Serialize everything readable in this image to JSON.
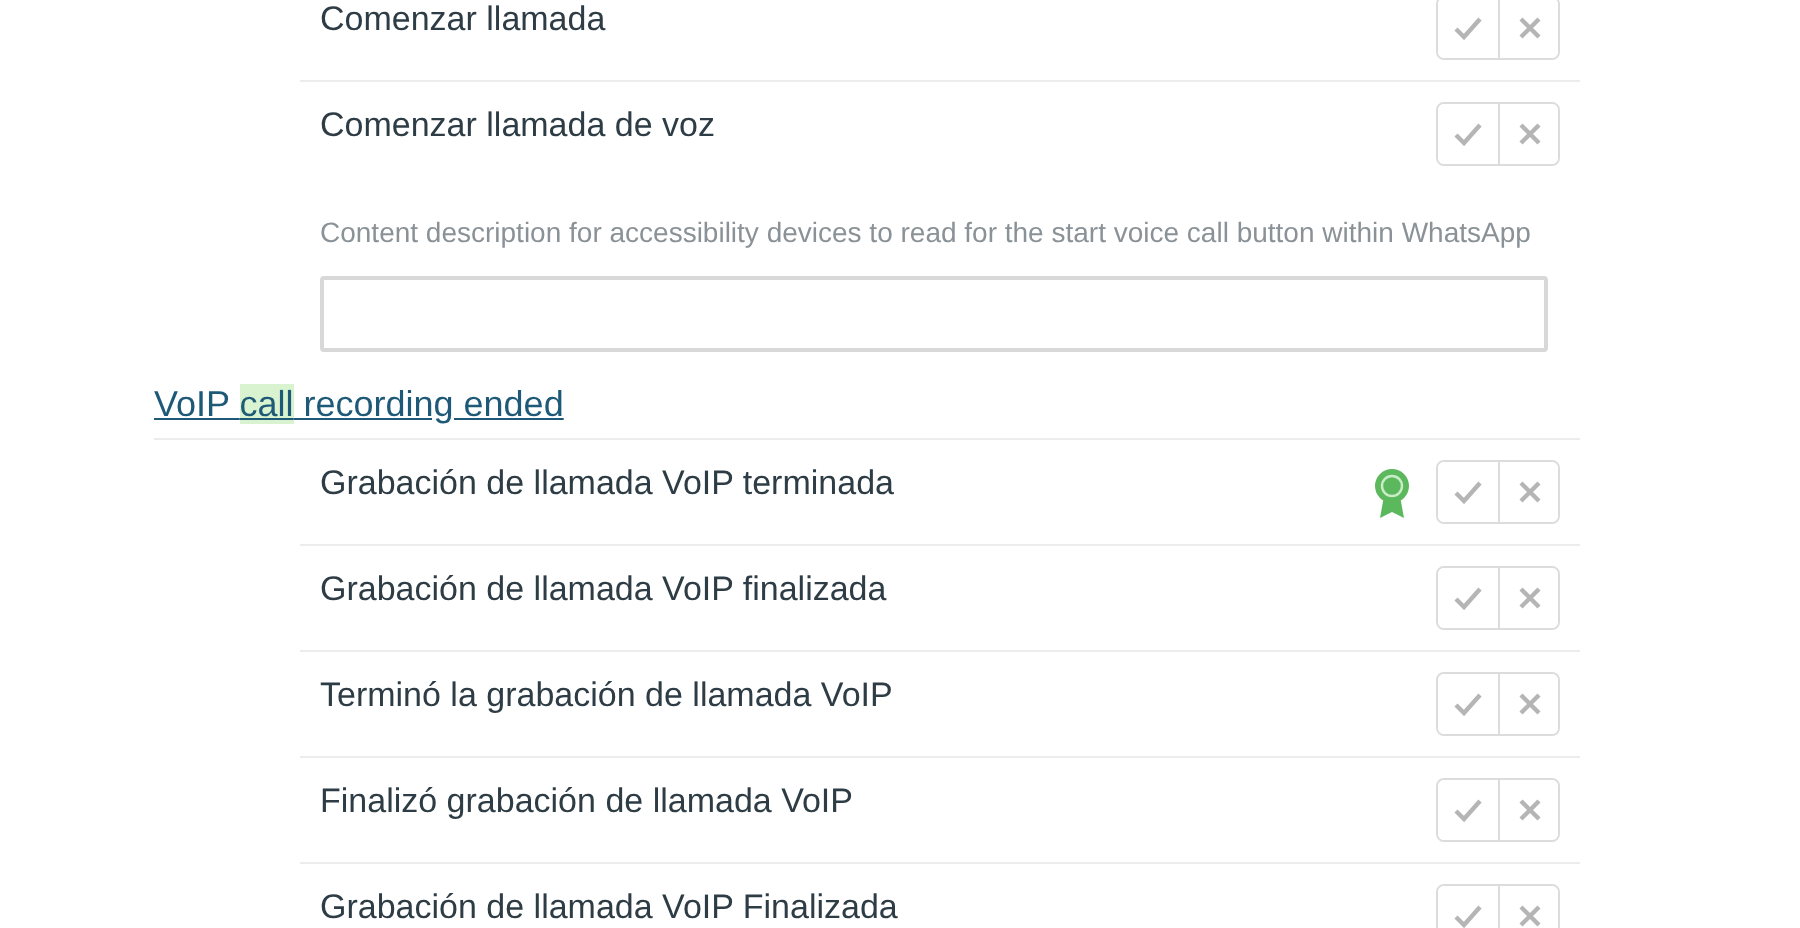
{
  "groups": [
    {
      "kind": "editable",
      "suggestions": [
        {
          "text": "Comenzar llamada",
          "awarded": false
        },
        {
          "text": "Comenzar llamada de voz",
          "awarded": false
        }
      ],
      "description": "Content description for accessibility devices to read for the start voice call button within WhatsApp"
    },
    {
      "kind": "list",
      "heading": [
        {
          "text": "VoIP ",
          "highlighted": false
        },
        {
          "text": "call",
          "highlighted": true
        },
        {
          "text": " recording ended",
          "highlighted": false
        }
      ],
      "suggestions": [
        {
          "text": "Grabación de llamada VoIP terminada",
          "awarded": true
        },
        {
          "text": "Grabación de llamada VoIP finalizada",
          "awarded": false
        },
        {
          "text": "Terminó la grabación de llamada VoIP",
          "awarded": false
        },
        {
          "text": "Finalizó grabación de llamada VoIP",
          "awarded": false
        },
        {
          "text": "Grabación de llamada VoIP Finalizada",
          "awarded": false
        }
      ]
    }
  ]
}
